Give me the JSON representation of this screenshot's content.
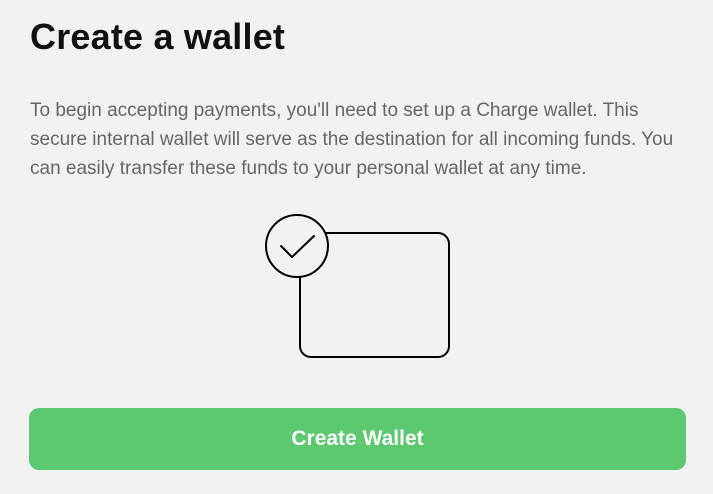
{
  "header": {
    "title": "Create a wallet"
  },
  "content": {
    "description": "To begin accepting payments, you'll need to set up a Charge wallet. This secure internal wallet will serve as the destination for all incoming funds. You can easily transfer these funds to your personal wallet at any time."
  },
  "illustration": {
    "icon": "wallet-check-icon"
  },
  "actions": {
    "create_wallet_label": "Create Wallet"
  },
  "colors": {
    "background": "#f2f2f2",
    "button": "#5cc86f",
    "button_text": "#ffffff",
    "title": "#111111",
    "description": "#666666",
    "line_art": "#000000"
  }
}
